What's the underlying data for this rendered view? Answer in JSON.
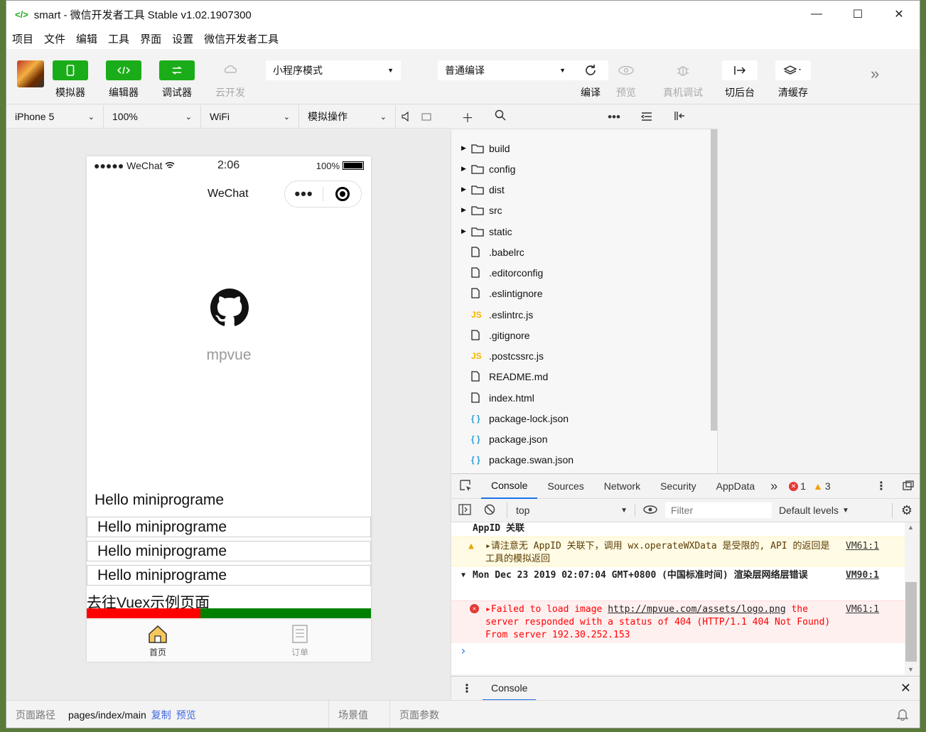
{
  "window": {
    "logo": "</>",
    "title": "smart - 微信开发者工具 Stable v1.02.1907300",
    "minimize": "—",
    "maximize": "☐",
    "close": "✕"
  },
  "menu": [
    "项目",
    "文件",
    "编辑",
    "工具",
    "界面",
    "设置",
    "微信开发者工具"
  ],
  "toolbar": {
    "simulator": "模拟器",
    "editor": "编辑器",
    "debugger": "调试器",
    "cloud": "云开发",
    "mode": "小程序模式",
    "compile_mode": "普通编译",
    "compile": "编译",
    "preview": "预览",
    "remote_debug": "真机调试",
    "background": "切后台",
    "clear_cache": "清缓存"
  },
  "simulator_bar": {
    "device": "iPhone 5",
    "zoom": "100%",
    "network": "WiFi",
    "operation": "模拟操作"
  },
  "phone": {
    "carrier": "●●●●● WeChat",
    "time": "2:06",
    "battery_pct": "100%",
    "nav_title": "WeChat",
    "capsule_dots": "•••",
    "logo_text": "mpvue",
    "hello_plain": "Hello miniprograme",
    "cards": [
      "Hello miniprograme",
      "Hello miniprograme",
      "Hello miniprograme"
    ],
    "vuex_link": "去往Vuex示例页面",
    "progress": 0.4,
    "tabs": [
      {
        "label": "首页",
        "icon": "home-icon",
        "active": true
      },
      {
        "label": "订单",
        "icon": "order-icon",
        "active": false
      }
    ]
  },
  "footer": {
    "path_label": "页面路径",
    "path": "pages/index/main",
    "copy": "复制",
    "preview": "预览",
    "scene": "场景值",
    "params": "页面参数"
  },
  "explorer": {
    "folders": [
      "build",
      "config",
      "dist",
      "src",
      "static"
    ],
    "files": [
      {
        "name": ".babelrc",
        "type": "file"
      },
      {
        "name": ".editorconfig",
        "type": "file"
      },
      {
        "name": ".eslintignore",
        "type": "file"
      },
      {
        "name": ".eslintrc.js",
        "type": "js"
      },
      {
        "name": ".gitignore",
        "type": "file"
      },
      {
        "name": ".postcssrc.js",
        "type": "js"
      },
      {
        "name": "README.md",
        "type": "file"
      },
      {
        "name": "index.html",
        "type": "file"
      },
      {
        "name": "package-lock.json",
        "type": "json"
      },
      {
        "name": "package.json",
        "type": "json"
      },
      {
        "name": "package.swan.json",
        "type": "json"
      }
    ]
  },
  "devtools": {
    "tabs": [
      "Console",
      "Sources",
      "Network",
      "Security",
      "AppData"
    ],
    "more": "»",
    "error_count": "1",
    "warning_count": "3",
    "context": "top",
    "filter_placeholder": "Filter",
    "levels": "Default levels",
    "lines": {
      "appid": "AppID 关联",
      "warn_text": "▸请注意无 AppID 关联下，调用 wx.operateWXData 是受限的, API 的返回是工具的模拟返回",
      "warn_src": "VM61:1",
      "group_text": "Mon Dec 23 2019 02:07:04 GMT+0800 (中国标准时间) 渲染层网络层错误",
      "group_src": "VM90:1",
      "err_prefix": "▸Failed to load image ",
      "err_url": "http://mpvue.com/assets/logo.png",
      "err_rest": "the server responded with a status of 404 (HTTP/1.1 404 Not Found) From server 192.30.252.153",
      "err_src": "VM61:1",
      "prompt": "›"
    },
    "drawer_tab": "Console"
  }
}
